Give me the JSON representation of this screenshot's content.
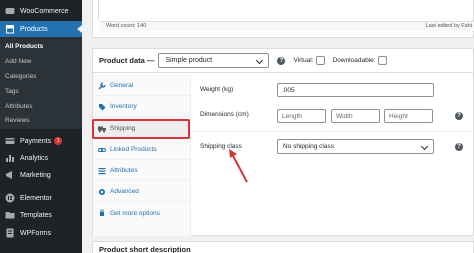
{
  "sidebar": {
    "woocommerce": "WooCommerce",
    "products": "Products",
    "submenu": [
      "All Products",
      "Add New",
      "Categories",
      "Tags",
      "Attributes",
      "Reviews"
    ],
    "payments": "Payments",
    "payments_badge": "1",
    "analytics": "Analytics",
    "marketing": "Marketing",
    "elementor": "Elementor",
    "templates": "Templates",
    "wpforms": "WPForms"
  },
  "editor": {
    "word_count": "Word count: 140",
    "last_edited": "Last edited by Fahi"
  },
  "product_data": {
    "title": "Product data —",
    "type_value": "Simple product",
    "virtual_label": "Virtual:",
    "downloadable_label": "Downloadable:",
    "tabs": [
      "General",
      "Inventory",
      "Shipping",
      "Linked Products",
      "Attributes",
      "Advanced",
      "Get more options"
    ],
    "weight_label": "Weight (kg)",
    "weight_value": ".005",
    "dimensions_label": "Dimensions (cm)",
    "length_placeholder": "Length",
    "width_placeholder": "Width",
    "height_placeholder": "Height",
    "shipping_class_label": "Shipping class",
    "shipping_class_value": "No shipping class",
    "help": "?"
  },
  "short_description": {
    "title": "Product short description"
  },
  "colors": {
    "accent": "#2271b1",
    "highlight": "#d63638",
    "sidebar_bg": "#1d2327"
  }
}
